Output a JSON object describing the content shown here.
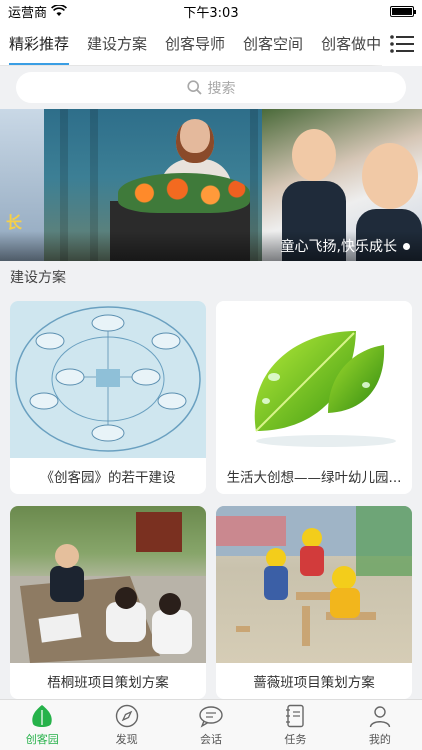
{
  "status_bar": {
    "carrier": "运营商",
    "time": "下午3:03"
  },
  "tabs": [
    {
      "label": "精彩推荐",
      "active": true
    },
    {
      "label": "建设方案",
      "active": false
    },
    {
      "label": "创客导师",
      "active": false
    },
    {
      "label": "创客空间",
      "active": false
    },
    {
      "label": "创客做中学",
      "active": false
    }
  ],
  "search": {
    "placeholder": "搜索"
  },
  "banner": {
    "left_partial_text": "长",
    "caption": "童心飞扬,快乐成长"
  },
  "section": {
    "title": "建设方案"
  },
  "cards": [
    {
      "title": "《创客园》的若干建设"
    },
    {
      "title": "生活大创想——绿叶幼儿园..."
    },
    {
      "title": "梧桐班项目策划方案"
    },
    {
      "title": "蔷薇班项目策划方案"
    }
  ],
  "bottom_nav": [
    {
      "label": "创客园",
      "icon": "leaf-icon",
      "active": true
    },
    {
      "label": "发现",
      "icon": "compass-icon",
      "active": false
    },
    {
      "label": "会话",
      "icon": "chat-icon",
      "active": false
    },
    {
      "label": "任务",
      "icon": "notebook-icon",
      "active": false
    },
    {
      "label": "我的",
      "icon": "person-icon",
      "active": false
    }
  ],
  "colors": {
    "accent_green": "#26b24a",
    "tab_underline": "#3a9ee4",
    "background": "#f0f1f3"
  }
}
